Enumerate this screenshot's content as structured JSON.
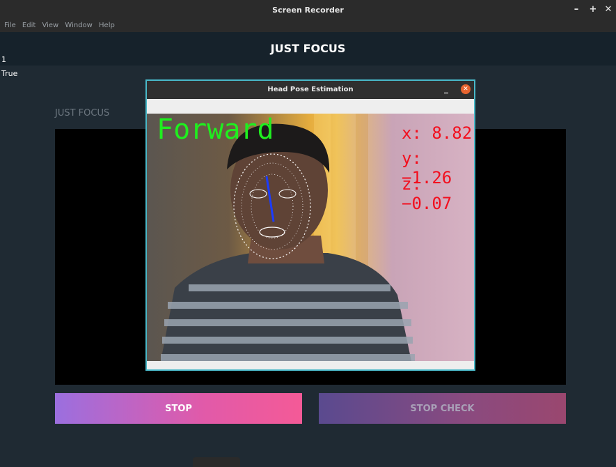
{
  "window": {
    "title": "Screen Recorder",
    "controls": [
      "–",
      "+",
      "✕"
    ]
  },
  "menu": [
    "File",
    "Edit",
    "View",
    "Window",
    "Help"
  ],
  "header": {
    "title": "JUST FOCUS"
  },
  "log_lines": [
    "1",
    "True"
  ],
  "section_label": "JUST FOCUS",
  "buttons": {
    "stop": "STOP",
    "stop_check": "STOP CHECK"
  },
  "popup": {
    "title": "Head Pose Estimation",
    "pose_label": "Forward",
    "x_readout": "x: 8.82",
    "y_readout": "y: −1.26",
    "z_readout": "z: −0.07"
  },
  "colors": {
    "pose_label": "#1fef1f",
    "readouts": "#f20f1e",
    "popup_border": "#49b8c8",
    "stop_button": "#e15aa9"
  },
  "icons": {
    "popup_minimize": "minimize-icon",
    "popup_close": "close-icon"
  }
}
